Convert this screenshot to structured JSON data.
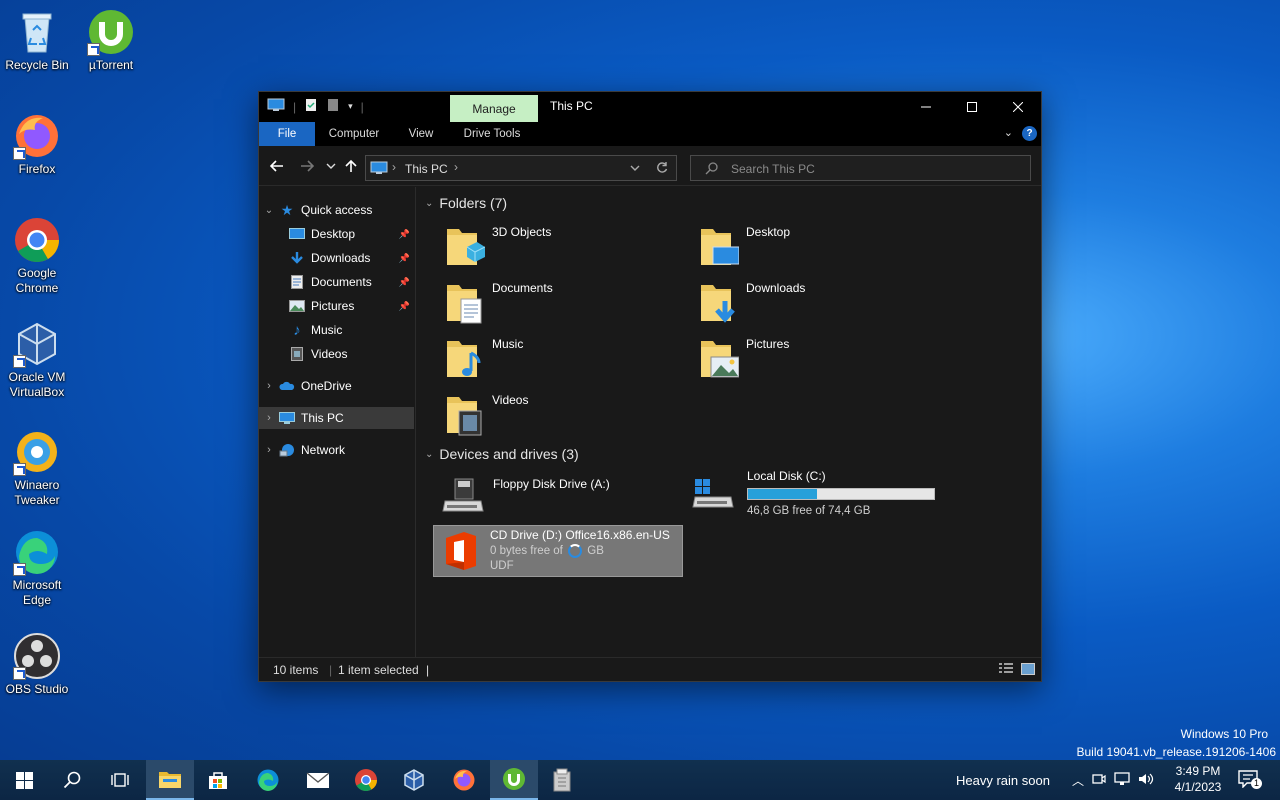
{
  "desktop": {
    "icons": [
      {
        "label": "Recycle Bin"
      },
      {
        "label": "µTorrent"
      },
      {
        "label": "Firefox"
      },
      {
        "label": "Google Chrome"
      },
      {
        "label": "Oracle VM VirtualBox"
      },
      {
        "label": "Winaero Tweaker"
      },
      {
        "label": "Microsoft Edge"
      },
      {
        "label": "OBS Studio"
      }
    ]
  },
  "window": {
    "title": "This PC",
    "manage_tab": "Manage",
    "ribbon_tabs": {
      "file": "File",
      "computer": "Computer",
      "view": "View",
      "drive_tools": "Drive Tools"
    },
    "address": {
      "location": "This PC"
    },
    "search": {
      "placeholder": "Search This PC"
    },
    "sidebar": {
      "quick_access": "Quick access",
      "items": [
        {
          "label": "Desktop",
          "icon": "desktop-icon"
        },
        {
          "label": "Downloads",
          "icon": "download-icon"
        },
        {
          "label": "Documents",
          "icon": "documents-icon"
        },
        {
          "label": "Pictures",
          "icon": "pictures-icon"
        },
        {
          "label": "Music",
          "icon": "music-icon"
        },
        {
          "label": "Videos",
          "icon": "videos-icon"
        }
      ],
      "onedrive": "OneDrive",
      "this_pc": "This PC",
      "network": "Network"
    },
    "folders_header": "Folders (7)",
    "folders": [
      {
        "name": "3D Objects"
      },
      {
        "name": "Desktop"
      },
      {
        "name": "Documents"
      },
      {
        "name": "Downloads"
      },
      {
        "name": "Music"
      },
      {
        "name": "Pictures"
      },
      {
        "name": "Videos"
      }
    ],
    "drives_header": "Devices and drives (3)",
    "drives": {
      "floppy": {
        "name": "Floppy Disk Drive (A:)"
      },
      "local": {
        "name": "Local Disk (C:)",
        "free": "46,8 GB free of 74,4 GB",
        "used_fraction": 0.37
      },
      "cd": {
        "name": "CD Drive (D:) Office16.x86.en-US",
        "free": "0 bytes free of",
        "free_unit": "GB",
        "fs": "UDF"
      }
    },
    "status": {
      "items": "10 items",
      "selected": "1 item selected"
    }
  },
  "watermark": {
    "line1": "Windows 10 Pro",
    "line2": "Build 19041.vb_release.191206-1406"
  },
  "taskbar": {
    "weather": "Heavy rain soon",
    "time": "3:49 PM",
    "date": "4/1/2023",
    "notification_count": "1"
  },
  "colors": {
    "accent": "#1a66c2",
    "manage_tab": "#c6efc4",
    "progress": "#26a0da"
  }
}
